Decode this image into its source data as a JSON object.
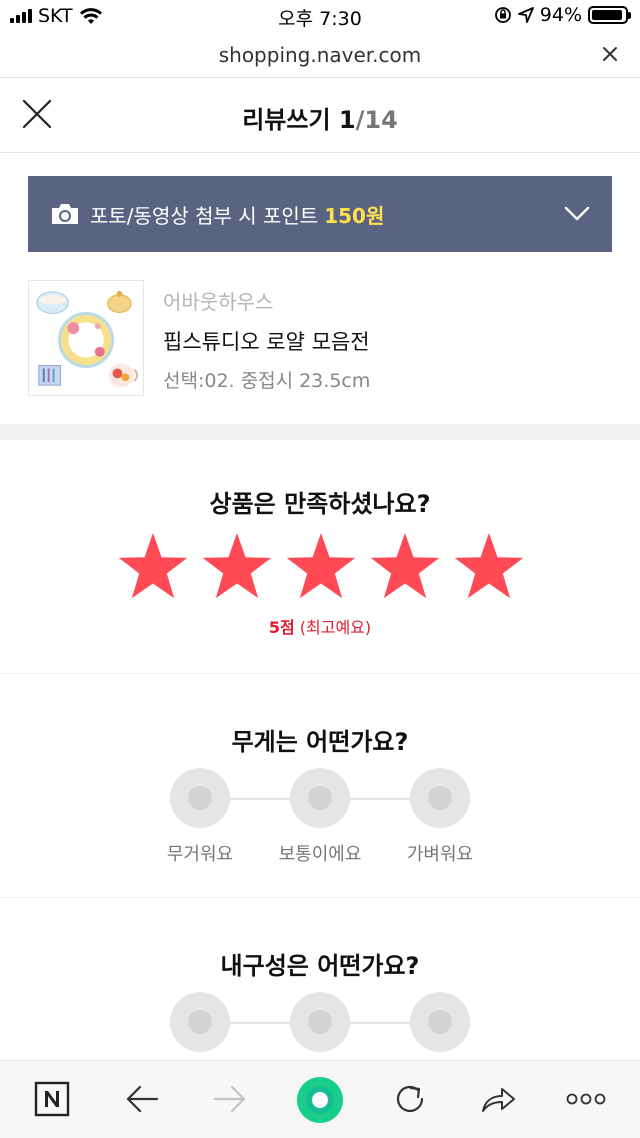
{
  "status_bar": {
    "carrier": "SKT",
    "time": "오후 7:30",
    "battery": "94%",
    "battery_level": 0.94
  },
  "url_bar": {
    "url": "shopping.naver.com"
  },
  "header": {
    "title": "리뷰쓰기",
    "current": "1",
    "total": "/14"
  },
  "banner": {
    "text": "포토/동영상 첨부 시 포인트",
    "points": "150원",
    "bg_color": "#5a6482",
    "points_color": "#ffe14d"
  },
  "product": {
    "brand": "어바웃하우스",
    "name": "핍스튜디오 로얄 모음전",
    "option": "선택:02. 중접시 23.5cm"
  },
  "rating": {
    "question": "상품은 만족하셨나요?",
    "stars_filled": 5,
    "stars_total": 5,
    "score": "5점",
    "score_desc": "(최고예요)",
    "star_color": "#ff4a55"
  },
  "weight_question": {
    "question": "무게는 어떤가요?",
    "options": [
      "무거워요",
      "보통이에요",
      "가벼워요"
    ]
  },
  "durability_question": {
    "question": "내구성은 어떤가요?"
  },
  "toolbar": {
    "items": [
      "naver-home",
      "back",
      "forward",
      "green-dot",
      "reload",
      "share",
      "more"
    ]
  }
}
